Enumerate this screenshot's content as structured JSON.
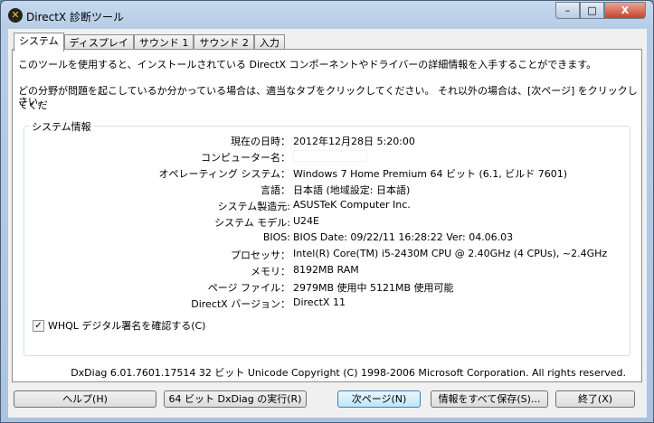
{
  "window": {
    "title": "DirectX 診断ツール",
    "min": "–",
    "max": "□",
    "close": "X"
  },
  "tabs": [
    "システム",
    "ディスプレイ",
    "サウンド 1",
    "サウンド 2",
    "入力"
  ],
  "intro": {
    "line1": "このツールを使用すると、インストールされている DirectX コンポーネントやドライバーの詳細情報を入手することができます。",
    "line2": "どの分野が問題を起こしているか分かっている場合は、適当なタブをクリックしてください。 それ以外の場合は、[次ページ] をクリックしてくだ",
    "line3": "さい。"
  },
  "system_info": {
    "title": "システム情報",
    "rows": [
      {
        "label": "現在の日時：",
        "value": "2012年12月28日  5:20:00"
      },
      {
        "label": "コンピューター名：",
        "value": ""
      },
      {
        "label": "オペレーティング システム：",
        "value": "Windows 7 Home Premium 64 ビット (6.1, ビルド 7601)"
      },
      {
        "label": "言語：",
        "value": "日本語 (地域設定: 日本語)"
      },
      {
        "label": "システム製造元:",
        "value": "ASUSTeK Computer Inc."
      },
      {
        "label": "システム モデル:",
        "value": "U24E"
      },
      {
        "label": "BIOS:",
        "value": "BIOS Date: 09/22/11 16:28:22 Ver: 04.06.03"
      },
      {
        "label": "プロセッサ：",
        "value": "Intel(R) Core(TM) i5-2430M CPU @ 2.40GHz (4 CPUs), ~2.4GHz"
      },
      {
        "label": "メモリ：",
        "value": "8192MB RAM"
      },
      {
        "label": "ページ ファイル：",
        "value": "2979MB 使用中 5121MB 使用可能"
      },
      {
        "label": "DirectX バージョン：",
        "value": "DirectX 11"
      }
    ]
  },
  "whql": {
    "label": "WHQL デジタル署名を確認する(C)",
    "checked": true,
    "mark": "✓"
  },
  "copyright": "DxDiag 6.01.7601.17514 32 ビット Unicode  Copyright (C) 1998-2006 Microsoft Corporation.  All rights reserved.",
  "buttons": {
    "help": "ヘルプ(H)",
    "run64": "64 ビット DxDiag の実行(R)",
    "next": "次ページ(N)",
    "save": "情報をすべて保存(S)...",
    "exit": "終了(X)"
  }
}
